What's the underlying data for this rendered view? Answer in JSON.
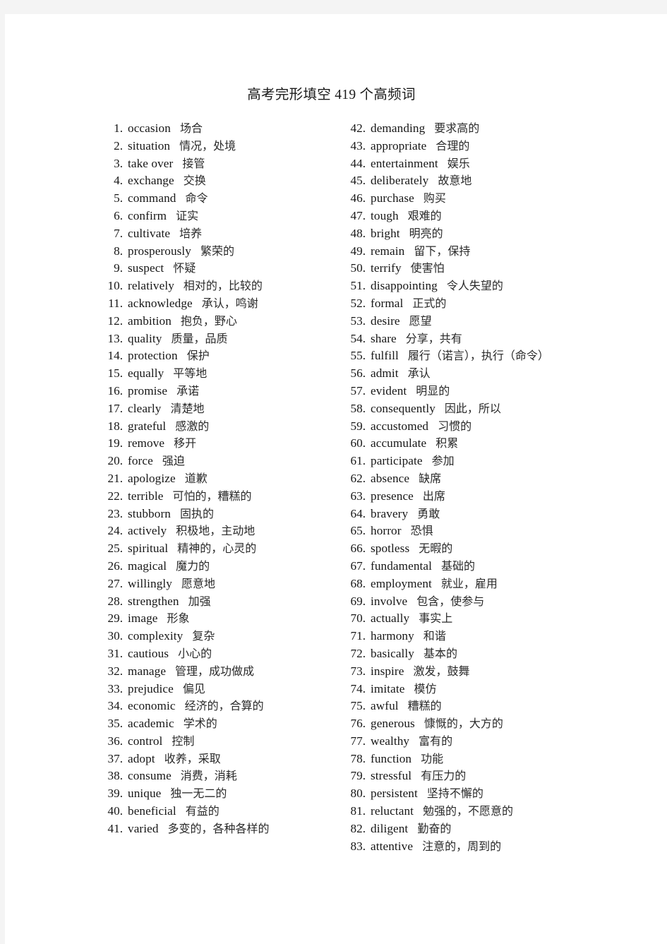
{
  "document": {
    "title": "高考完形填空 419 个高频词"
  },
  "columns": {
    "left": [
      {
        "index": "1.",
        "term": "occasion",
        "gloss": "场合"
      },
      {
        "index": "2.",
        "term": "situation",
        "gloss": "情况，处境"
      },
      {
        "index": "3.",
        "term": "take  over",
        "gloss": "接管"
      },
      {
        "index": "4.",
        "term": "exchange",
        "gloss": "交换"
      },
      {
        "index": "5.",
        "term": "command",
        "gloss": "命令"
      },
      {
        "index": "6.",
        "term": "confirm",
        "gloss": "证实"
      },
      {
        "index": "7.",
        "term": "cultivate",
        "gloss": "培养"
      },
      {
        "index": "8.",
        "term": "prosperously",
        "gloss": "繁荣的"
      },
      {
        "index": "9.",
        "term": "suspect",
        "gloss": "怀疑"
      },
      {
        "index": "10.",
        "term": "relatively",
        "gloss": "相对的，比较的"
      },
      {
        "index": "11.",
        "term": "acknowledge",
        "gloss": "承认，鸣谢"
      },
      {
        "index": "12.",
        "term": "ambition",
        "gloss": "抱负，野心"
      },
      {
        "index": "13.",
        "term": "quality",
        "gloss": "质量，品质"
      },
      {
        "index": "14.",
        "term": "protection",
        "gloss": "保护"
      },
      {
        "index": "15.",
        "term": "equally",
        "gloss": "平等地"
      },
      {
        "index": "16.",
        "term": "promise",
        "gloss": "承诺"
      },
      {
        "index": "17.",
        "term": "clearly",
        "gloss": "清楚地"
      },
      {
        "index": "18.",
        "term": "grateful",
        "gloss": "感激的"
      },
      {
        "index": "19.",
        "term": "remove",
        "gloss": "移开"
      },
      {
        "index": "20.",
        "term": "force",
        "gloss": "强迫"
      },
      {
        "index": "21.",
        "term": "apologize",
        "gloss": "道歉"
      },
      {
        "index": "22.",
        "term": "terrible",
        "gloss": "可怕的，糟糕的"
      },
      {
        "index": "23.",
        "term": "stubborn",
        "gloss": "固执的"
      },
      {
        "index": "24.",
        "term": "actively",
        "gloss": "积极地，主动地"
      },
      {
        "index": "25.",
        "term": "spiritual",
        "gloss": "精神的，心灵的"
      },
      {
        "index": "26.",
        "term": "magical",
        "gloss": "魔力的"
      },
      {
        "index": "27.",
        "term": "willingly",
        "gloss": "愿意地"
      },
      {
        "index": "28.",
        "term": "strengthen",
        "gloss": "加强"
      },
      {
        "index": "29.",
        "term": "image",
        "gloss": "形象"
      },
      {
        "index": "30.",
        "term": "complexity",
        "gloss": "复杂"
      },
      {
        "index": "31.",
        "term": "cautious",
        "gloss": "小心的"
      },
      {
        "index": "32.",
        "term": "manage",
        "gloss": "管理，成功做成"
      },
      {
        "index": "33.",
        "term": "prejudice",
        "gloss": "偏见"
      },
      {
        "index": "34.",
        "term": "economic",
        "gloss": "经济的，合算的"
      },
      {
        "index": "35.",
        "term": "academic",
        "gloss": "学术的"
      },
      {
        "index": "36.",
        "term": "control",
        "gloss": "控制"
      },
      {
        "index": "37.",
        "term": "adopt",
        "gloss": "收养，采取"
      },
      {
        "index": "38.",
        "term": "consume",
        "gloss": "消费，消耗"
      },
      {
        "index": "39.",
        "term": "unique",
        "gloss": "独一无二的"
      },
      {
        "index": "40.",
        "term": "beneficial",
        "gloss": "有益的"
      },
      {
        "index": "41.",
        "term": "varied",
        "gloss": "多变的，各种各样的"
      }
    ],
    "right": [
      {
        "index": "42.",
        "term": "demanding",
        "gloss": "要求高的"
      },
      {
        "index": "43.",
        "term": "appropriate",
        "gloss": "合理的"
      },
      {
        "index": "44.",
        "term": "entertainment",
        "gloss": "娱乐"
      },
      {
        "index": "45.",
        "term": "deliberately",
        "gloss": "故意地"
      },
      {
        "index": "46.",
        "term": "purchase",
        "gloss": "购买"
      },
      {
        "index": "47.",
        "term": "tough",
        "gloss": "艰难的"
      },
      {
        "index": "48.",
        "term": "bright",
        "gloss": "明亮的"
      },
      {
        "index": "49.",
        "term": "remain",
        "gloss": "留下，保持"
      },
      {
        "index": "50.",
        "term": "terrify",
        "gloss": "使害怕"
      },
      {
        "index": "51.",
        "term": "disappointing",
        "gloss": "令人失望的"
      },
      {
        "index": "52.",
        "term": "formal",
        "gloss": "正式的"
      },
      {
        "index": "53.",
        "term": "desire",
        "gloss": "愿望"
      },
      {
        "index": "54.",
        "term": "share",
        "gloss": "分享，共有"
      },
      {
        "index": "55.",
        "term": "fulfill",
        "gloss": "履行（诺言），执行（命令）"
      },
      {
        "index": "56.",
        "term": "admit",
        "gloss": "承认"
      },
      {
        "index": "57.",
        "term": "evident",
        "gloss": "明显的"
      },
      {
        "index": "58.",
        "term": "consequently",
        "gloss": "因此，所以"
      },
      {
        "index": "59.",
        "term": "accustomed",
        "gloss": "习惯的"
      },
      {
        "index": "60.",
        "term": "accumulate",
        "gloss": "积累"
      },
      {
        "index": "61.",
        "term": "participate",
        "gloss": "参加"
      },
      {
        "index": "62.",
        "term": "absence",
        "gloss": "缺席"
      },
      {
        "index": "63.",
        "term": "presence",
        "gloss": "出席"
      },
      {
        "index": "64.",
        "term": "bravery",
        "gloss": "勇敢"
      },
      {
        "index": "65.",
        "term": "horror",
        "gloss": "恐惧"
      },
      {
        "index": "66.",
        "term": "spotless",
        "gloss": "无暇的"
      },
      {
        "index": "67.",
        "term": "fundamental",
        "gloss": "基础的"
      },
      {
        "index": "68.",
        "term": "employment",
        "gloss": "就业，雇用"
      },
      {
        "index": "69.",
        "term": "involve",
        "gloss": "包含，使参与"
      },
      {
        "index": "70.",
        "term": "actually",
        "gloss": "事实上"
      },
      {
        "index": "71.",
        "term": "harmony",
        "gloss": "和谐"
      },
      {
        "index": "72.",
        "term": "basically",
        "gloss": "基本的"
      },
      {
        "index": "73.",
        "term": "inspire",
        "gloss": "激发，鼓舞"
      },
      {
        "index": "74.",
        "term": "imitate",
        "gloss": "模仿"
      },
      {
        "index": "75.",
        "term": "awful",
        "gloss": "糟糕的"
      },
      {
        "index": "76.",
        "term": "generous",
        "gloss": "慷慨的，大方的"
      },
      {
        "index": "77.",
        "term": "wealthy",
        "gloss": "富有的"
      },
      {
        "index": "78.",
        "term": "function",
        "gloss": "功能"
      },
      {
        "index": "79.",
        "term": "stressful",
        "gloss": "有压力的"
      },
      {
        "index": "80.",
        "term": "persistent",
        "gloss": "坚持不懈的"
      },
      {
        "index": "81.",
        "term": "reluctant",
        "gloss": "勉强的，不愿意的"
      },
      {
        "index": "82.",
        "term": "diligent",
        "gloss": "勤奋的"
      },
      {
        "index": "83.",
        "term": "attentive",
        "gloss": "注意的，周到的"
      }
    ]
  }
}
